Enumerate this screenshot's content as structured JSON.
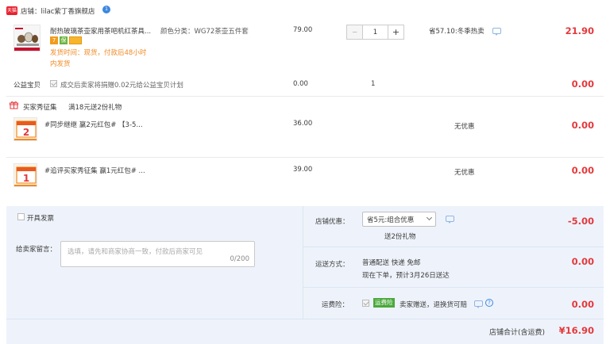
{
  "shop": {
    "badge": "天猫",
    "label": "店铺：lilac紫丁香旗舰店",
    "flag_icon": "blue-badge-icon"
  },
  "item": {
    "title": "耐热玻璃茶壶家用茶吧机红茶具...",
    "sku": "颜色分类：WG72茶壶五件套",
    "ship_line1": "发货时间：现货，付款后48小时",
    "ship_line2": "内发货",
    "price": "79.00",
    "qty": "1",
    "minus": "−",
    "plus": "+",
    "promo": "省57.10:冬季热卖",
    "total": "21.90",
    "tags": [
      "7",
      "保",
      "☐"
    ]
  },
  "charity": {
    "label": "公益宝贝",
    "text": "成交后卖家将捐赠0.02元给公益宝贝计划",
    "price": "0.00",
    "qty": "1",
    "total": "0.00"
  },
  "promo_block": {
    "label": "买家秀征集",
    "desc": "满18元送2份礼物"
  },
  "gifts": [
    {
      "title": "#同步继继 赢2元红包# 【3-5...",
      "price": "36.00",
      "discount": "无优惠",
      "total": "0.00",
      "num": "2"
    },
    {
      "title": "#追评买家秀征集 赢1元红包# ...",
      "price": "39.00",
      "discount": "无优惠",
      "total": "0.00",
      "num": "1"
    }
  ],
  "invoice": {
    "label": "开具发票"
  },
  "message": {
    "label": "给卖家留言：",
    "placeholder": "选填，请先和商家协商一致，付款后商家可见",
    "counter": "0/200"
  },
  "shop_discount": {
    "label": "店铺优惠：",
    "value": "省5元:组合优惠",
    "sub": "送2份礼物",
    "amount": "-5.00"
  },
  "delivery": {
    "label": "运送方式：",
    "line1": "普通配送 快递 免邮",
    "line2": "现在下单，预计3月26日送达",
    "amount": "0.00"
  },
  "insurance": {
    "label": "运费险：",
    "tag": "运费险",
    "text": "卖家赠送，退换货可赔",
    "amount": "0.00"
  },
  "summary": {
    "label": "店铺合计(含运费)",
    "amount": "¥16.90"
  },
  "colors": {
    "price_red": "#e4393c",
    "tmall_red": "#e8212e",
    "panel_bg": "#eef3fb",
    "link_blue": "#3c87e0"
  }
}
